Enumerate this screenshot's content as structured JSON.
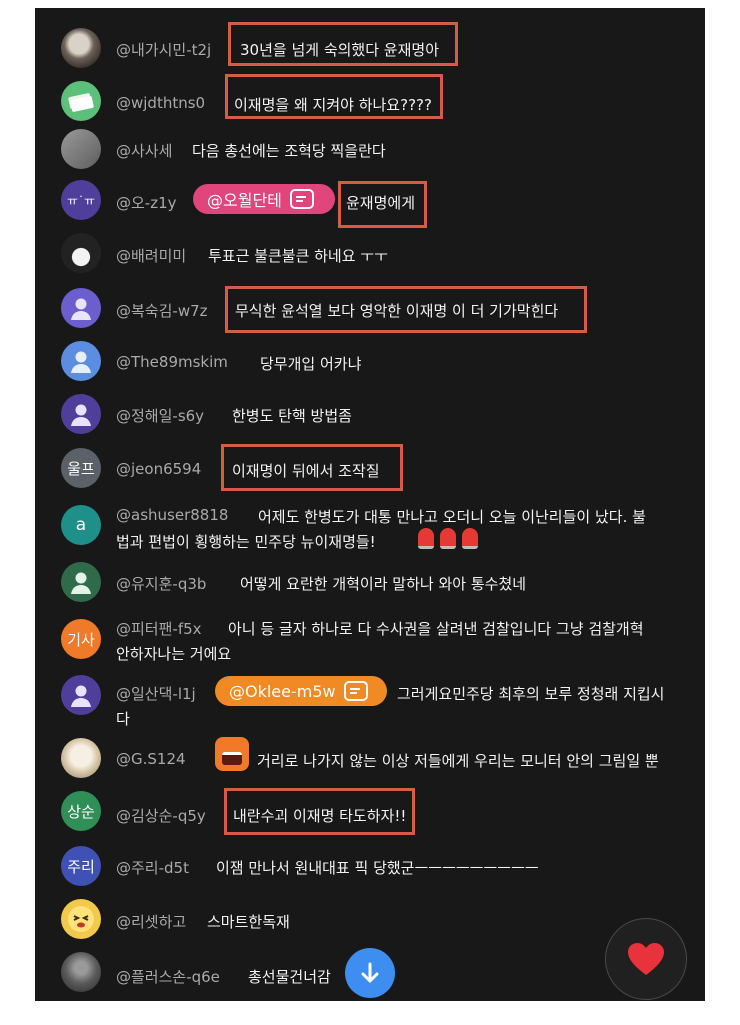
{
  "comments": [
    {
      "username": "@내가시민-t2j",
      "message": "30년을 넘게 숙의했다 윤재명아"
    },
    {
      "username": "@wjdthtns0",
      "message": "이재명을 왜 지켜야 하나요????"
    },
    {
      "username": "@사사세",
      "message": "다음 총선에는 조혁당 찍을란다"
    },
    {
      "username": "@오-z1y",
      "avatar_text": "ㅠ˙ㅠ",
      "mention": "@오월단테",
      "message": "윤재명에게"
    },
    {
      "username": "@배려미미",
      "message": "투표근 불큰불큰 하네요 ㅜㅜ"
    },
    {
      "username": "@복숙김-w7z",
      "message": "무식한 윤석열 보다 영악한 이재명 이 더 기가막힌다"
    },
    {
      "username": "@The89mskim",
      "message": "당무개입 어카냐"
    },
    {
      "username": "@정해일-s6y",
      "message": "한병도 탄핵 방법좀"
    },
    {
      "username": "@jeon6594",
      "avatar_text": "울프",
      "message": "이재명이 뒤에서 조작질"
    },
    {
      "username": "@ashuser8818",
      "avatar_text": "a",
      "message": "어제도 한병도가 대통 만나고 오더니 오늘 이난리들이 났다. 불법과 편법이 횡행하는 민주당 뉴이재명들!",
      "message_line1": "어제도 한병도가 대통 만나고 오더니 오늘 이난리들이 났다. 불",
      "message_line2": "법과 편법이 횡행하는 민주당 뉴이재명들!"
    },
    {
      "username": "@유지훈-q3b",
      "message": "어떻게 요란한 개혁이라 말하나 와아 통수쳤네"
    },
    {
      "username": "@피터팬-f5x",
      "avatar_text": "기사",
      "message_line1": "아니 등 글자 하나로 다 수사권을 살려낸 검찰입니다 그냥 검찰개혁",
      "message_line2": "안하자나는 거에요"
    },
    {
      "username": "@일산댁-l1j",
      "mention": "@Oklee-m5w",
      "message_line1": "그러게요민주당 최후의 보루 정청래 지킵시",
      "message_line2": "다"
    },
    {
      "username": "@G.S124",
      "message": "거리로 나가지 않는 이상 저들에게 우리는 모니터 안의 그림일 뿐"
    },
    {
      "username": "@김상순-q5y",
      "avatar_text": "상순",
      "message": "내란수괴 이재명 타도하자!!"
    },
    {
      "username": "@주리-d5t",
      "avatar_text": "주리",
      "message": "이잼 만나서 원내대표 픽 당했군ㅡㅡㅡㅡㅡㅡㅡㅡㅡ"
    },
    {
      "username": "@리셋하고",
      "message": "스마트한독재"
    },
    {
      "username": "@플러스손-q6e",
      "message": "총선물건너감"
    }
  ],
  "colors": {
    "highlight": "#d65c45",
    "mention_pink": "#e0457b",
    "mention_orange": "#f08a24",
    "fab_blue": "#3d8ef0",
    "heart_red": "#e8323c"
  },
  "icons": {
    "scroll_down": "arrow-down-icon",
    "reaction": "heart-icon",
    "mention": "chat-bubble-icon"
  }
}
